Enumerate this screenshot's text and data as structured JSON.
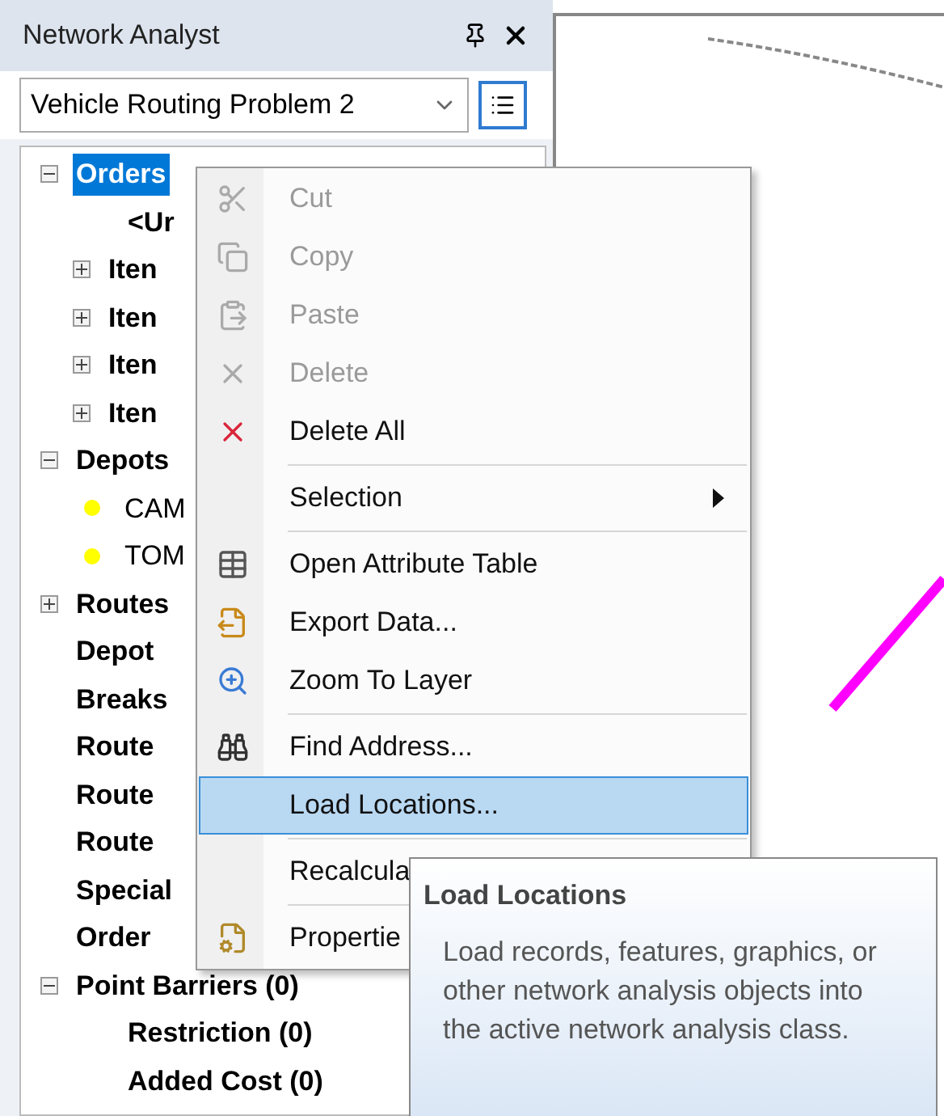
{
  "panel": {
    "title": "Network Analyst",
    "solver": {
      "value": "Vehicle Routing Problem 2"
    }
  },
  "tree": [
    {
      "label": "Orders",
      "expanded": true,
      "selected": true,
      "children": [
        {
          "label": "<Ur"
        },
        {
          "label": "Iten",
          "expanded": false
        },
        {
          "label": "Iten",
          "expanded": false
        },
        {
          "label": "Iten",
          "expanded": false
        },
        {
          "label": "Iten",
          "expanded": false
        }
      ]
    },
    {
      "label": "Depots",
      "expanded": true,
      "selected": false,
      "children": [
        {
          "label": "CAM",
          "color": "#ffff00"
        },
        {
          "label": "TOM",
          "color": "#ffff00"
        }
      ]
    },
    {
      "label": "Routes",
      "expanded": false,
      "selected": false
    },
    {
      "label": "Depot",
      "selected": false
    },
    {
      "label": "Breaks",
      "selected": false
    },
    {
      "label": "Route",
      "selected": false
    },
    {
      "label": "Route",
      "selected": false
    },
    {
      "label": "Route",
      "selected": false
    },
    {
      "label": "Special",
      "selected": false
    },
    {
      "label": "Order",
      "selected": false
    },
    {
      "label": "Point Barriers (0)",
      "expanded": true,
      "selected": false,
      "children": [
        {
          "label": "Restriction (0)"
        },
        {
          "label": "Added Cost (0)"
        }
      ]
    }
  ],
  "context_menu": [
    {
      "kind": "item",
      "label": "Cut",
      "disabled": true,
      "selected": false
    },
    {
      "kind": "item",
      "label": "Copy",
      "disabled": true,
      "selected": false
    },
    {
      "kind": "item",
      "label": "Paste",
      "disabled": true,
      "selected": false
    },
    {
      "kind": "item",
      "label": "Delete",
      "disabled": true,
      "selected": false
    },
    {
      "kind": "item",
      "label": "Delete All",
      "disabled": false,
      "selected": false
    },
    {
      "kind": "separator"
    },
    {
      "kind": "item",
      "label": "Selection",
      "disabled": false,
      "selected": false,
      "submenu": true
    },
    {
      "kind": "separator"
    },
    {
      "kind": "item",
      "label": "Open Attribute Table",
      "disabled": false,
      "selected": false
    },
    {
      "kind": "item",
      "label": "Export Data...",
      "disabled": false,
      "selected": false
    },
    {
      "kind": "item",
      "label": "Zoom To Layer",
      "disabled": false,
      "selected": false
    },
    {
      "kind": "separator"
    },
    {
      "kind": "item",
      "label": "Find Address...",
      "disabled": false,
      "selected": false
    },
    {
      "kind": "item",
      "label": "Load Locations...",
      "disabled": false,
      "selected": true
    },
    {
      "kind": "separator"
    },
    {
      "kind": "item",
      "label": "Recalcula",
      "disabled": false,
      "selected": false
    },
    {
      "kind": "separator"
    },
    {
      "kind": "item",
      "label": "Propertie",
      "disabled": false,
      "selected": false
    }
  ],
  "tooltip": {
    "title": "Load Locations",
    "text": "Load records, features, graphics, or other network analysis objects into the active network analysis class."
  }
}
